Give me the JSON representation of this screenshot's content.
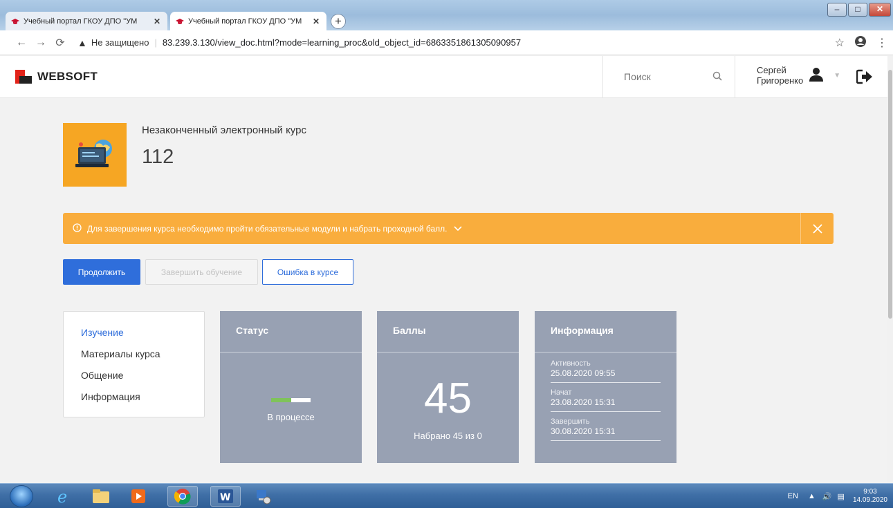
{
  "browser": {
    "tabs": [
      {
        "title": "Учебный портал ГКОУ ДПО \"УМ",
        "active": false
      },
      {
        "title": "Учебный портал ГКОУ ДПО \"УМ",
        "active": true
      }
    ],
    "new_tab": "+",
    "window_controls": {
      "minimize": "–",
      "maximize": "□",
      "close": "✕"
    },
    "security_label": "Не защищено",
    "url": "83.239.3.130/view_doc.html?mode=learning_proc&old_object_id=6863351861305090957"
  },
  "header": {
    "logo_text": "WEBSOFT",
    "search_placeholder": "Поиск",
    "user_first_name": "Сергей",
    "user_last_name": "Григоренко"
  },
  "course": {
    "type_label": "Незаконченный электронный курс",
    "name": "112"
  },
  "alert": {
    "text": "Для завершения курса необходимо пройти обязательные модули и набрать проходной балл."
  },
  "actions": {
    "continue": "Продолжить",
    "finish": "Завершить обучение",
    "report_error": "Ошибка в курсе"
  },
  "sidenav": {
    "items": [
      {
        "label": "Изучение",
        "active": true
      },
      {
        "label": "Материалы курса",
        "active": false
      },
      {
        "label": "Общение",
        "active": false
      },
      {
        "label": "Информация",
        "active": false
      }
    ]
  },
  "status_card": {
    "title": "Статус",
    "status_text": "В процессе",
    "progress_percent": 50
  },
  "points_card": {
    "title": "Баллы",
    "value": "45",
    "caption": "Набрано 45 из 0"
  },
  "info_card": {
    "title": "Информация",
    "rows": [
      {
        "label": "Активность",
        "value": "25.08.2020 09:55"
      },
      {
        "label": "Начат",
        "value": "23.08.2020 15:31"
      },
      {
        "label": "Завершить",
        "value": "30.08.2020 15:31"
      }
    ]
  },
  "taskbar": {
    "language": "EN",
    "time": "9:03",
    "date": "14.09.2020"
  },
  "colors": {
    "accent_blue": "#2f6edb",
    "alert_orange": "#f9ad3d",
    "card_gray": "#98a1b3",
    "thumb_orange": "#f6a623",
    "logo_red": "#e2231a",
    "progress_green": "#7fc35a"
  }
}
